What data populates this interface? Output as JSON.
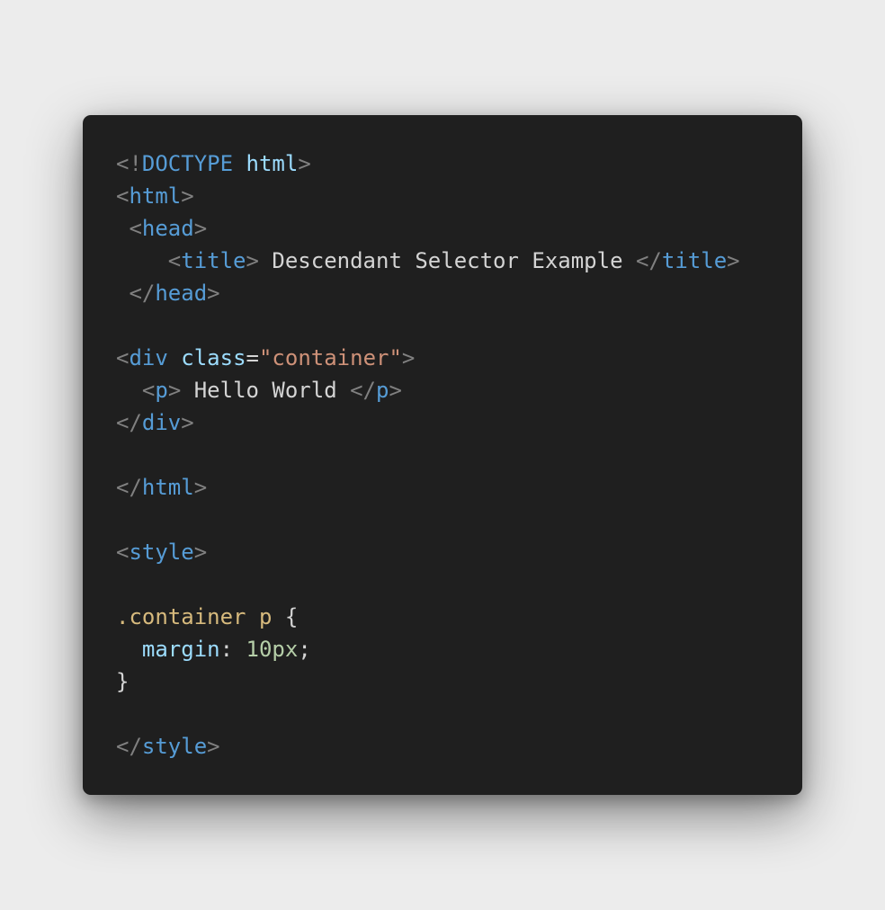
{
  "colors": {
    "background": "#ececec",
    "editor_background": "#1f1f1f",
    "punct": "#808080",
    "tag": "#569cd6",
    "attr": "#9cdcfe",
    "string": "#ce9178",
    "text": "#d4d4d4",
    "selector": "#d7ba7d",
    "number": "#b5cea8"
  },
  "code_lines": [
    [
      [
        "<!",
        "punct"
      ],
      [
        "DOCTYPE",
        "tag"
      ],
      [
        " ",
        "text"
      ],
      [
        "html",
        "attr"
      ],
      [
        ">",
        "punct"
      ]
    ],
    [
      [
        "<",
        "punct"
      ],
      [
        "html",
        "tag"
      ],
      [
        ">",
        "punct"
      ]
    ],
    [
      [
        " ",
        "text"
      ],
      [
        "<",
        "punct"
      ],
      [
        "head",
        "tag"
      ],
      [
        ">",
        "punct"
      ]
    ],
    [
      [
        "    ",
        "text"
      ],
      [
        "<",
        "punct"
      ],
      [
        "title",
        "tag"
      ],
      [
        ">",
        "punct"
      ],
      [
        " Descendant Selector Example ",
        "text"
      ],
      [
        "</",
        "punct"
      ],
      [
        "title",
        "tag"
      ],
      [
        ">",
        "punct"
      ]
    ],
    [
      [
        " ",
        "text"
      ],
      [
        "</",
        "punct"
      ],
      [
        "head",
        "tag"
      ],
      [
        ">",
        "punct"
      ]
    ],
    [],
    [
      [
        "<",
        "punct"
      ],
      [
        "div",
        "tag"
      ],
      [
        " ",
        "text"
      ],
      [
        "class",
        "attr"
      ],
      [
        "=",
        "text"
      ],
      [
        "\"container\"",
        "string"
      ],
      [
        ">",
        "punct"
      ]
    ],
    [
      [
        "  ",
        "text"
      ],
      [
        "<",
        "punct"
      ],
      [
        "p",
        "tag"
      ],
      [
        ">",
        "punct"
      ],
      [
        " Hello World ",
        "text"
      ],
      [
        "</",
        "punct"
      ],
      [
        "p",
        "tag"
      ],
      [
        ">",
        "punct"
      ]
    ],
    [
      [
        "</",
        "punct"
      ],
      [
        "div",
        "tag"
      ],
      [
        ">",
        "punct"
      ]
    ],
    [],
    [
      [
        "</",
        "punct"
      ],
      [
        "html",
        "tag"
      ],
      [
        ">",
        "punct"
      ]
    ],
    [],
    [
      [
        "<",
        "punct"
      ],
      [
        "style",
        "tag"
      ],
      [
        ">",
        "punct"
      ]
    ],
    [],
    [
      [
        ".container p",
        "selector"
      ],
      [
        " {",
        "text"
      ]
    ],
    [
      [
        "  ",
        "text"
      ],
      [
        "margin",
        "attr"
      ],
      [
        ": ",
        "text"
      ],
      [
        "10px",
        "number"
      ],
      [
        ";",
        "text"
      ]
    ],
    [
      [
        "}",
        "text"
      ]
    ],
    [],
    [
      [
        "</",
        "punct"
      ],
      [
        "style",
        "tag"
      ],
      [
        ">",
        "punct"
      ]
    ]
  ]
}
